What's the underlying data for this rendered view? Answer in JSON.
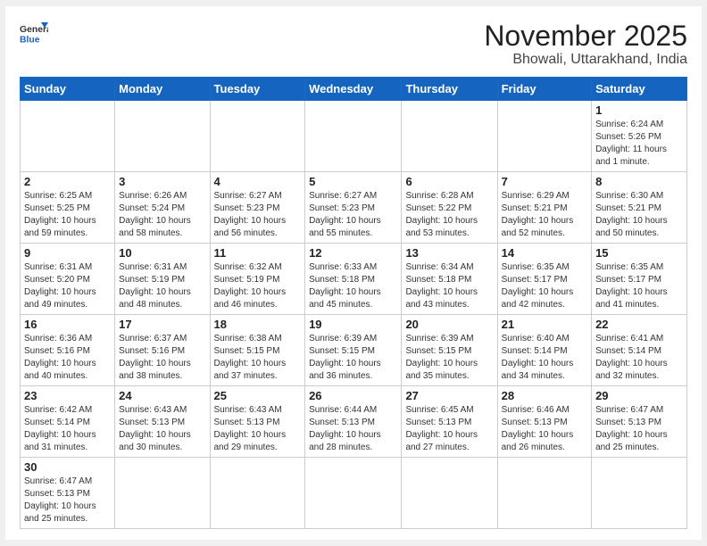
{
  "logo": {
    "general": "General",
    "blue": "Blue"
  },
  "title": "November 2025",
  "subtitle": "Bhowali, Uttarakhand, India",
  "weekdays": [
    "Sunday",
    "Monday",
    "Tuesday",
    "Wednesday",
    "Thursday",
    "Friday",
    "Saturday"
  ],
  "days": [
    {
      "num": "",
      "info": ""
    },
    {
      "num": "",
      "info": ""
    },
    {
      "num": "",
      "info": ""
    },
    {
      "num": "",
      "info": ""
    },
    {
      "num": "",
      "info": ""
    },
    {
      "num": "",
      "info": ""
    },
    {
      "num": "1",
      "info": "Sunrise: 6:24 AM\nSunset: 5:26 PM\nDaylight: 11 hours and 1 minute."
    },
    {
      "num": "2",
      "info": "Sunrise: 6:25 AM\nSunset: 5:25 PM\nDaylight: 10 hours and 59 minutes."
    },
    {
      "num": "3",
      "info": "Sunrise: 6:26 AM\nSunset: 5:24 PM\nDaylight: 10 hours and 58 minutes."
    },
    {
      "num": "4",
      "info": "Sunrise: 6:27 AM\nSunset: 5:23 PM\nDaylight: 10 hours and 56 minutes."
    },
    {
      "num": "5",
      "info": "Sunrise: 6:27 AM\nSunset: 5:23 PM\nDaylight: 10 hours and 55 minutes."
    },
    {
      "num": "6",
      "info": "Sunrise: 6:28 AM\nSunset: 5:22 PM\nDaylight: 10 hours and 53 minutes."
    },
    {
      "num": "7",
      "info": "Sunrise: 6:29 AM\nSunset: 5:21 PM\nDaylight: 10 hours and 52 minutes."
    },
    {
      "num": "8",
      "info": "Sunrise: 6:30 AM\nSunset: 5:21 PM\nDaylight: 10 hours and 50 minutes."
    },
    {
      "num": "9",
      "info": "Sunrise: 6:31 AM\nSunset: 5:20 PM\nDaylight: 10 hours and 49 minutes."
    },
    {
      "num": "10",
      "info": "Sunrise: 6:31 AM\nSunset: 5:19 PM\nDaylight: 10 hours and 48 minutes."
    },
    {
      "num": "11",
      "info": "Sunrise: 6:32 AM\nSunset: 5:19 PM\nDaylight: 10 hours and 46 minutes."
    },
    {
      "num": "12",
      "info": "Sunrise: 6:33 AM\nSunset: 5:18 PM\nDaylight: 10 hours and 45 minutes."
    },
    {
      "num": "13",
      "info": "Sunrise: 6:34 AM\nSunset: 5:18 PM\nDaylight: 10 hours and 43 minutes."
    },
    {
      "num": "14",
      "info": "Sunrise: 6:35 AM\nSunset: 5:17 PM\nDaylight: 10 hours and 42 minutes."
    },
    {
      "num": "15",
      "info": "Sunrise: 6:35 AM\nSunset: 5:17 PM\nDaylight: 10 hours and 41 minutes."
    },
    {
      "num": "16",
      "info": "Sunrise: 6:36 AM\nSunset: 5:16 PM\nDaylight: 10 hours and 40 minutes."
    },
    {
      "num": "17",
      "info": "Sunrise: 6:37 AM\nSunset: 5:16 PM\nDaylight: 10 hours and 38 minutes."
    },
    {
      "num": "18",
      "info": "Sunrise: 6:38 AM\nSunset: 5:15 PM\nDaylight: 10 hours and 37 minutes."
    },
    {
      "num": "19",
      "info": "Sunrise: 6:39 AM\nSunset: 5:15 PM\nDaylight: 10 hours and 36 minutes."
    },
    {
      "num": "20",
      "info": "Sunrise: 6:39 AM\nSunset: 5:15 PM\nDaylight: 10 hours and 35 minutes."
    },
    {
      "num": "21",
      "info": "Sunrise: 6:40 AM\nSunset: 5:14 PM\nDaylight: 10 hours and 34 minutes."
    },
    {
      "num": "22",
      "info": "Sunrise: 6:41 AM\nSunset: 5:14 PM\nDaylight: 10 hours and 32 minutes."
    },
    {
      "num": "23",
      "info": "Sunrise: 6:42 AM\nSunset: 5:14 PM\nDaylight: 10 hours and 31 minutes."
    },
    {
      "num": "24",
      "info": "Sunrise: 6:43 AM\nSunset: 5:13 PM\nDaylight: 10 hours and 30 minutes."
    },
    {
      "num": "25",
      "info": "Sunrise: 6:43 AM\nSunset: 5:13 PM\nDaylight: 10 hours and 29 minutes."
    },
    {
      "num": "26",
      "info": "Sunrise: 6:44 AM\nSunset: 5:13 PM\nDaylight: 10 hours and 28 minutes."
    },
    {
      "num": "27",
      "info": "Sunrise: 6:45 AM\nSunset: 5:13 PM\nDaylight: 10 hours and 27 minutes."
    },
    {
      "num": "28",
      "info": "Sunrise: 6:46 AM\nSunset: 5:13 PM\nDaylight: 10 hours and 26 minutes."
    },
    {
      "num": "29",
      "info": "Sunrise: 6:47 AM\nSunset: 5:13 PM\nDaylight: 10 hours and 25 minutes."
    },
    {
      "num": "30",
      "info": "Sunrise: 6:47 AM\nSunset: 5:13 PM\nDaylight: 10 hours and 25 minutes."
    },
    {
      "num": "",
      "info": ""
    },
    {
      "num": "",
      "info": ""
    },
    {
      "num": "",
      "info": ""
    },
    {
      "num": "",
      "info": ""
    },
    {
      "num": "",
      "info": ""
    }
  ]
}
